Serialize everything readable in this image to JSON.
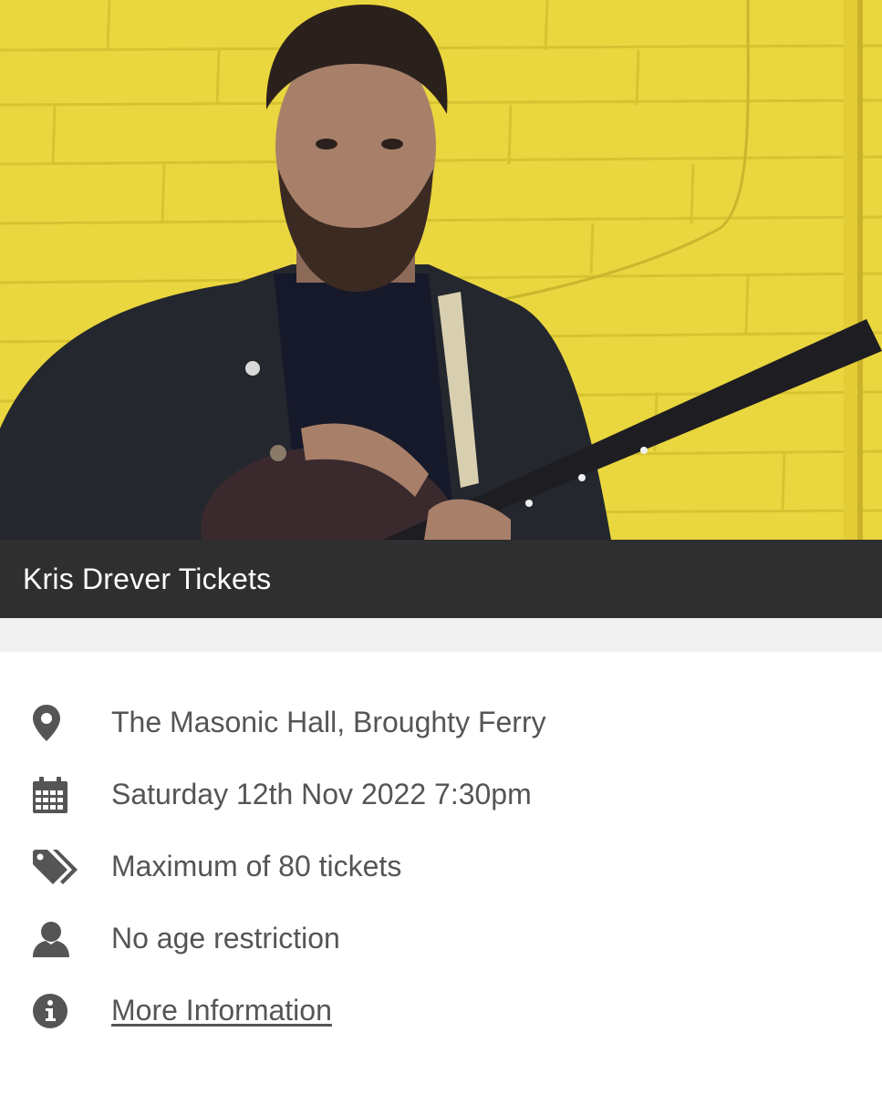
{
  "hero": {
    "image_description_icon": "artist-photo",
    "colors": {
      "wall": "#ead63e",
      "jacket": "#24272e"
    }
  },
  "event": {
    "title": "Kris Drever Tickets"
  },
  "details": {
    "venue": {
      "icon": "map-pin-icon",
      "text": "The Masonic Hall, Broughty Ferry"
    },
    "date": {
      "icon": "calendar-icon",
      "text": "Saturday 12th Nov 2022 7:30pm"
    },
    "tickets": {
      "icon": "tags-icon",
      "text": "Maximum of 80 tickets"
    },
    "age": {
      "icon": "user-icon",
      "text": "No age restriction"
    },
    "info": {
      "icon": "info-icon",
      "text": "More Information"
    }
  },
  "colors": {
    "title_bar": "#2f2f2f",
    "band": "#f0f0f0",
    "text": "#555555",
    "icon": "#555555"
  }
}
